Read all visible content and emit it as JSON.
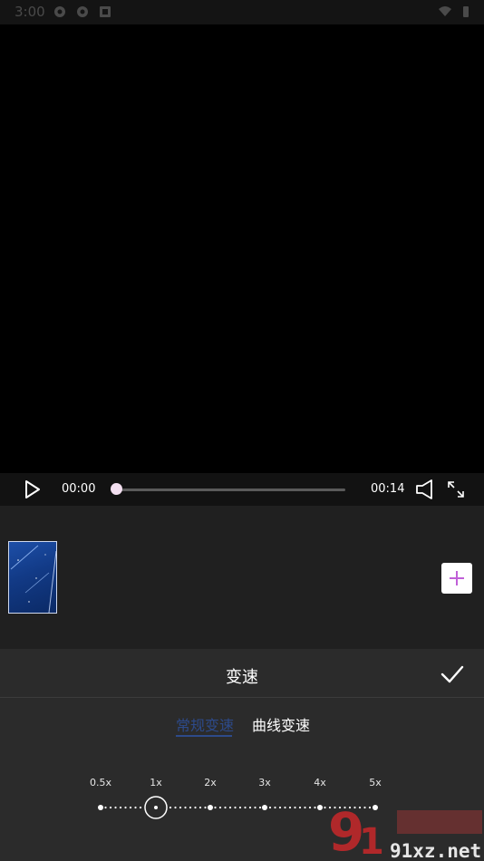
{
  "status_bar": {
    "time": "3:00",
    "icons": [
      "sync-icon",
      "sync-icon",
      "notification-icon",
      "wifi-icon",
      "battery-icon"
    ]
  },
  "player": {
    "current_time": "00:00",
    "total_time": "00:14",
    "progress": 0.0
  },
  "timeline": {
    "clip_count": 1,
    "add_label": "+"
  },
  "speed_panel": {
    "title": "变速",
    "tabs": [
      {
        "label": "常规变速",
        "active": true
      },
      {
        "label": "曲线变速",
        "active": false
      }
    ],
    "speeds": [
      "0.5x",
      "1x",
      "2x",
      "3x",
      "4x",
      "5x"
    ],
    "selected_speed": "1x"
  },
  "watermark": {
    "text": "91xz.net"
  }
}
